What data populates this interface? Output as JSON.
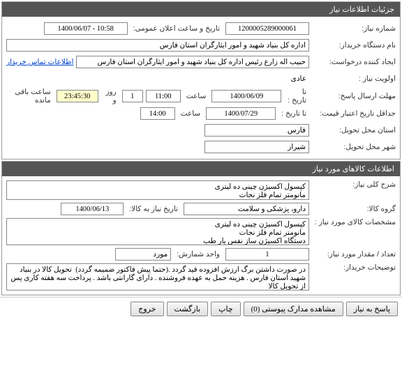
{
  "section1": {
    "title": "جزئیات اطلاعات نیاز",
    "request_no_label": "شماره نیاز:",
    "request_no": "1200005289000061",
    "announce_label": "تاریخ و ساعت اعلان عمومی:",
    "announce_value": "1400/06/07 - 10:58",
    "buyer_label": "نام دستگاه خریدار:",
    "buyer_value": "اداره کل بنیاد شهید و امور ایثارگران استان فارس",
    "creator_label": "ایجاد کننده درخواست:",
    "creator_value": "حبیب اله زارع رئیس اداره کل بنیاد شهید و امور ایثارگران استان فارس",
    "contact_link": "اطلاعات تماس خریدار",
    "priority_label": "اولویت نیاز :",
    "priority_value": "عادی",
    "deadline_label": "مهلت ارسال پاسخ:",
    "to_date_label": "تا تاریخ :",
    "deadline_date": "1400/06/09",
    "time_label": "ساعت",
    "deadline_time": "11:00",
    "days_value": "1",
    "days_and": "روز و",
    "remain_time": "23:45:30",
    "remain_label": "ساعت باقی مانده",
    "validity_label": "حداقل تاریخ اعتبار قیمت:",
    "validity_date": "1400/07/29",
    "validity_time": "14:00",
    "province_label": "استان محل تحویل:",
    "province_value": "فارس",
    "city_label": "شهر محل تحویل:",
    "city_value": "شیراز"
  },
  "section2": {
    "title": "اطلاعات کالاهای مورد نیاز",
    "desc_label": "شرح کلی نیاز:",
    "desc_value": "کپسول اکسیژن چینی ده لیتری\nمانومتر تمام فلز نجات",
    "group_label": "گروه کالا:",
    "group_value": "دارو، پزشکی و سلامت",
    "need_date_label": "تاریخ نیاز به کالا:",
    "need_date_value": "1400/06/13",
    "spec_label": "مشخصات کالای مورد نیاز :",
    "spec_value": "کپسول اکسیژن چینی ده لیتری\nمانومتر تمام فلز نجات\nدستگاه اکسیژن ساز نفس یار طب",
    "qty_label": "تعداد / مقدار مورد نیاز:",
    "qty_value": "1",
    "unit_label": "واحد شمارش:",
    "unit_value": "مورد",
    "notes_label": "توضیحات خریدار:",
    "notes_value": "در صورت داشتن برگ ارزش افزوده قید گردد .(حتما پیش فاکتور ضمیمه گردد)  تحویل کالا در بنیاد شهید استان فارس . هزینه حمل به عهده فروشنده . دارای گارانتی باشد . پرداخت سه هفته کاری پس از تحویل کالا"
  },
  "buttons": {
    "respond": "پاسخ به نیاز",
    "attachments": "مشاهده مدارک پیوستی (0)",
    "print": "چاپ",
    "back": "بازگشت",
    "exit": "خروج"
  }
}
